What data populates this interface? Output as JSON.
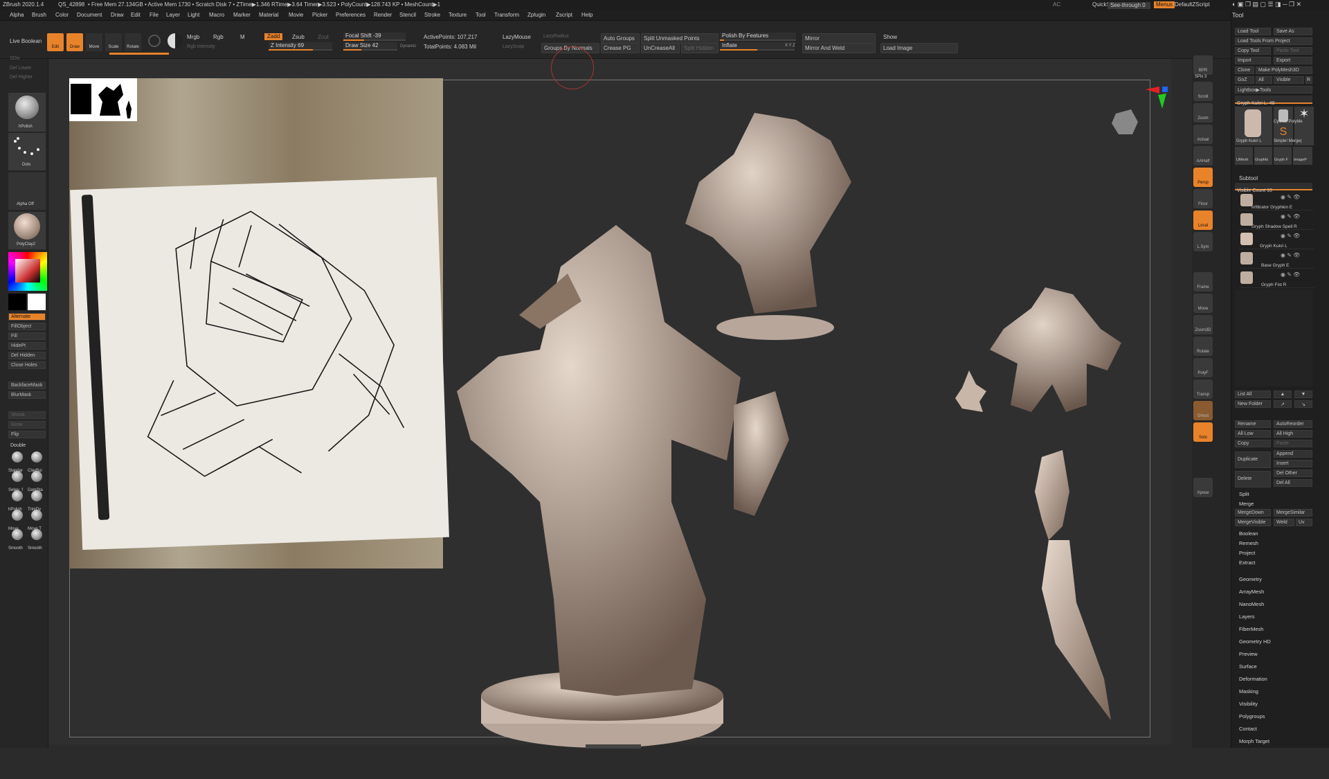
{
  "title_bar": {
    "app": "ZBrush 2020.1.4",
    "q": "QS_42898",
    "stats": "• Free Mem 27.134GB • Active Mem 1730 • Scratch Disk 7 • ZTime▶1.346 RTime▶3.64 Timer▶3.523 • PolyCount▶128.743 KP • MeshCount▶1",
    "ac": "AC",
    "quicksave": "QuickSave",
    "see_through": "See-through  0",
    "menus": "Menus",
    "default_zscript": "DefaultZScript"
  },
  "menu": [
    "Alpha",
    "Brush",
    "Color",
    "Document",
    "Draw",
    "Edit",
    "File",
    "Layer",
    "Light",
    "Macro",
    "Marker",
    "Material",
    "Movie",
    "Picker",
    "Preferences",
    "Render",
    "Stencil",
    "Stroke",
    "Texture",
    "Tool",
    "Transform",
    "Zplugin",
    "Zscript",
    "Help"
  ],
  "top_shelf": {
    "live_boolean": "Live Boolean",
    "edit": "Edit",
    "draw": "Draw",
    "move": "Move",
    "scale": "Scale",
    "rotate": "Rotate",
    "mrgb": "Mrgb",
    "rgb": "Rgb",
    "m": "M",
    "rgb_intensity": "Rgb Intensity",
    "zadd": "Zadd",
    "zsub": "Zsub",
    "zcut": "Zcut",
    "z_intensity": "Z Intensity 69",
    "focal_shift": "Focal Shift -39",
    "draw_size": "Draw Size 42",
    "dynamic": "Dynamic",
    "active_points": "ActivePoints: 107,217",
    "total_points": "TotalPoints: 4.083 Mil",
    "lazymouse": "LazyMouse",
    "lazyradius": "LazyRadius",
    "lazysnap": "LazySnap",
    "auto_groups": "Auto Groups",
    "split_unmasked": "Split Unmasked Points",
    "groups_by_normals": "Groups By Normals",
    "crease_pg": "Crease PG",
    "uncrease_all": "UnCreaseAll",
    "split_hidden": "Split Hidden",
    "polish_by_features": "Polish By Features",
    "inflate": "Inflate",
    "mirror": "Mirror",
    "mirror_and_weld": "Mirror And Weld",
    "show": "Show",
    "load_image": "Load Image",
    "xyz": "X Y Z"
  },
  "left_shelf": {
    "sdiv": "SDiv",
    "del_lower": "Del Lower",
    "del_higher": "Del Higher",
    "brush": "hPolish",
    "stroke": "Dots",
    "alpha": "Alpha Off",
    "material": "PolyClay2",
    "alternate": "Alternate",
    "buttons": [
      "FillObject",
      "Fill",
      "HidePt",
      "Del Hidden",
      "Close Holes"
    ],
    "mask_buttons": [
      "BackfaceMask",
      "BlurMask"
    ],
    "grow_buttons": [
      "Shrink",
      "Grow",
      "Flip",
      "Double"
    ],
    "brushes": [
      "Standar",
      "ClayBui",
      "Selwy_f",
      "DamSta",
      "hPolish",
      "TrimDy",
      "Move",
      "Move T",
      "Smooth",
      "Smooth"
    ]
  },
  "right_shelf": [
    "BPR",
    "SPix 3",
    "Scroll",
    "Zoom",
    "Actual",
    "AAHalf",
    "Persp",
    "Floor",
    "Local",
    "L.Sym",
    "Frame",
    "Move",
    "Zoom3D",
    "Rotate",
    "PolyF",
    "Transp",
    "Ghost",
    "Solo",
    "Xpose"
  ],
  "tray": {
    "title": "Tool",
    "load_tool": "Load Tool",
    "save_as": "Save As",
    "load_tools_from_project": "Load Tools From Project",
    "copy_tool": "Copy Tool",
    "paste_tool": "Paste Tool",
    "import": "Import",
    "export": "Export",
    "clone": "Clone",
    "make_polymesh": "Make PolyMesh3D",
    "goz": "GoZ",
    "all": "All",
    "visible": "Visible",
    "r": "R",
    "lightbox_tools": "Lightbox▶Tools",
    "current_tool": "Gryph Kukri L. 48",
    "thumbs": [
      "Gryph Kukri L",
      "Cylinde PolyMe",
      "Simple! Merge(",
      "UMesh",
      "Gryphki",
      "Gryph F",
      "ImageP"
    ],
    "subtool": "Subtool",
    "visible_count": "Visible Count 10",
    "subtools": [
      "Infiltrator Gryphkin E",
      "Gryph Shadow Spell R",
      "Gryph Kukri L",
      "Base Gryph E",
      "Gryph Fist R"
    ],
    "list_all": "List All",
    "new_folder": "New Folder",
    "rename": "Rename",
    "auto_reorder": "AutoReorder",
    "all_low": "All Low",
    "all_high": "All High",
    "copy": "Copy",
    "paste": "Paste",
    "duplicate": "Duplicate",
    "append": "Append",
    "insert": "Insert",
    "delete": "Delete",
    "del_other": "Del Other",
    "del_all": "Del All",
    "split": "Split",
    "merge": "Merge",
    "merge_down": "MergeDown",
    "merge_similar": "MergeSimilar",
    "merge_visible": "MergeVisible",
    "weld": "Weld",
    "uv": "Uv",
    "boolean": "Boolean",
    "remesh": "Remesh",
    "project": "Project",
    "extract": "Extract",
    "sections": [
      "Geometry",
      "ArrayMesh",
      "NanoMesh",
      "Layers",
      "FiberMesh",
      "Geometry HD",
      "Preview",
      "Surface",
      "Deformation",
      "Masking",
      "Visibility",
      "Polygroups",
      "Contact",
      "Morph Target"
    ]
  }
}
